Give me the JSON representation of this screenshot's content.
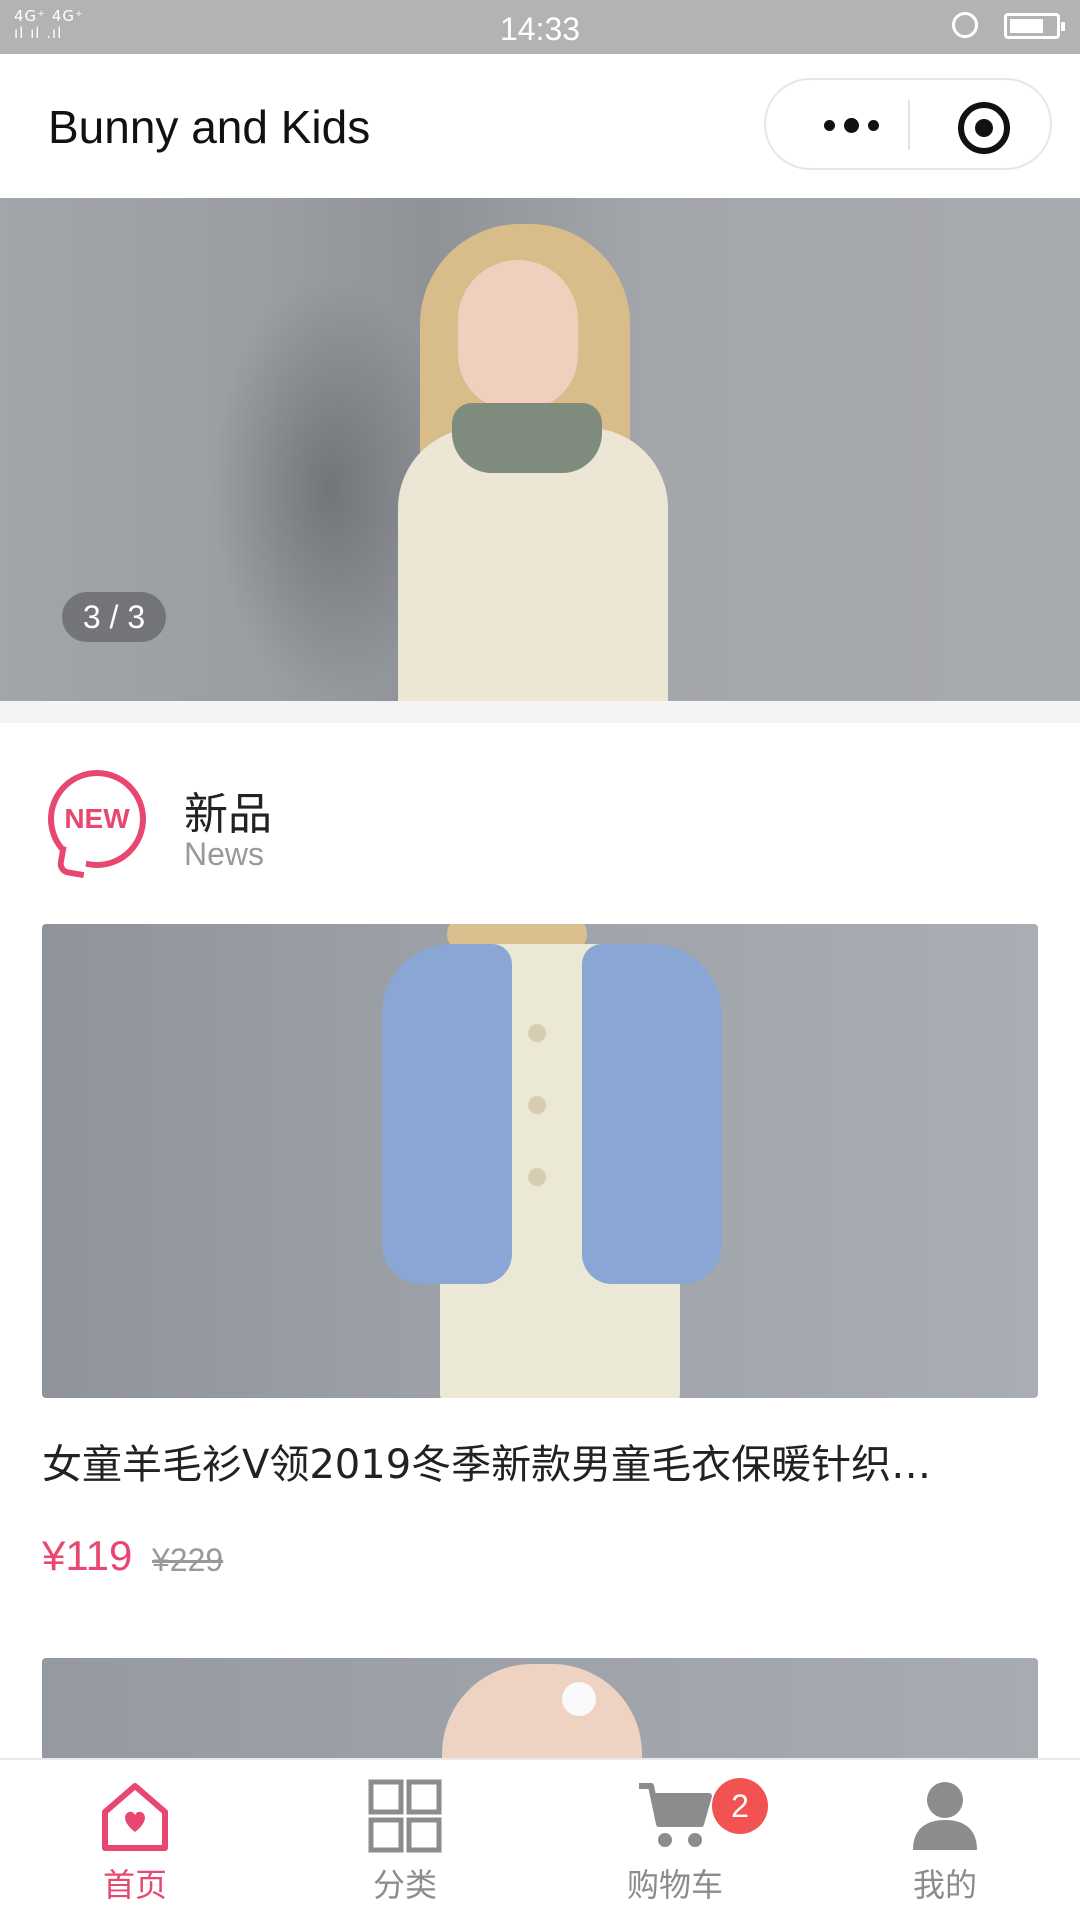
{
  "status_bar": {
    "signal_text": "4G⁺ 4G⁺ 2G\n2G..ıl ıl .ıl",
    "time": "14:33"
  },
  "nav": {
    "title": "Bunny and Kids"
  },
  "banner": {
    "counter": "3 / 3"
  },
  "section": {
    "icon_text": "NEW",
    "title": "新品",
    "subtitle": "News"
  },
  "product": {
    "title": "女童羊毛衫V领2019冬季新款男童毛衣保暖针织…",
    "price": "¥119",
    "original_price": "¥229"
  },
  "battery_level": 0.75,
  "tabs": [
    {
      "label": "首页",
      "icon": "home-heart-icon",
      "active": true
    },
    {
      "label": "分类",
      "icon": "grid-icon",
      "active": false
    },
    {
      "label": "购物车",
      "icon": "cart-icon",
      "active": false
    },
    {
      "label": "我的",
      "icon": "user-icon",
      "active": false
    }
  ],
  "cart_badge": "2",
  "colors": {
    "accent": "#e8476f",
    "badge": "#f25252",
    "inactive": "#8c8c8c"
  }
}
